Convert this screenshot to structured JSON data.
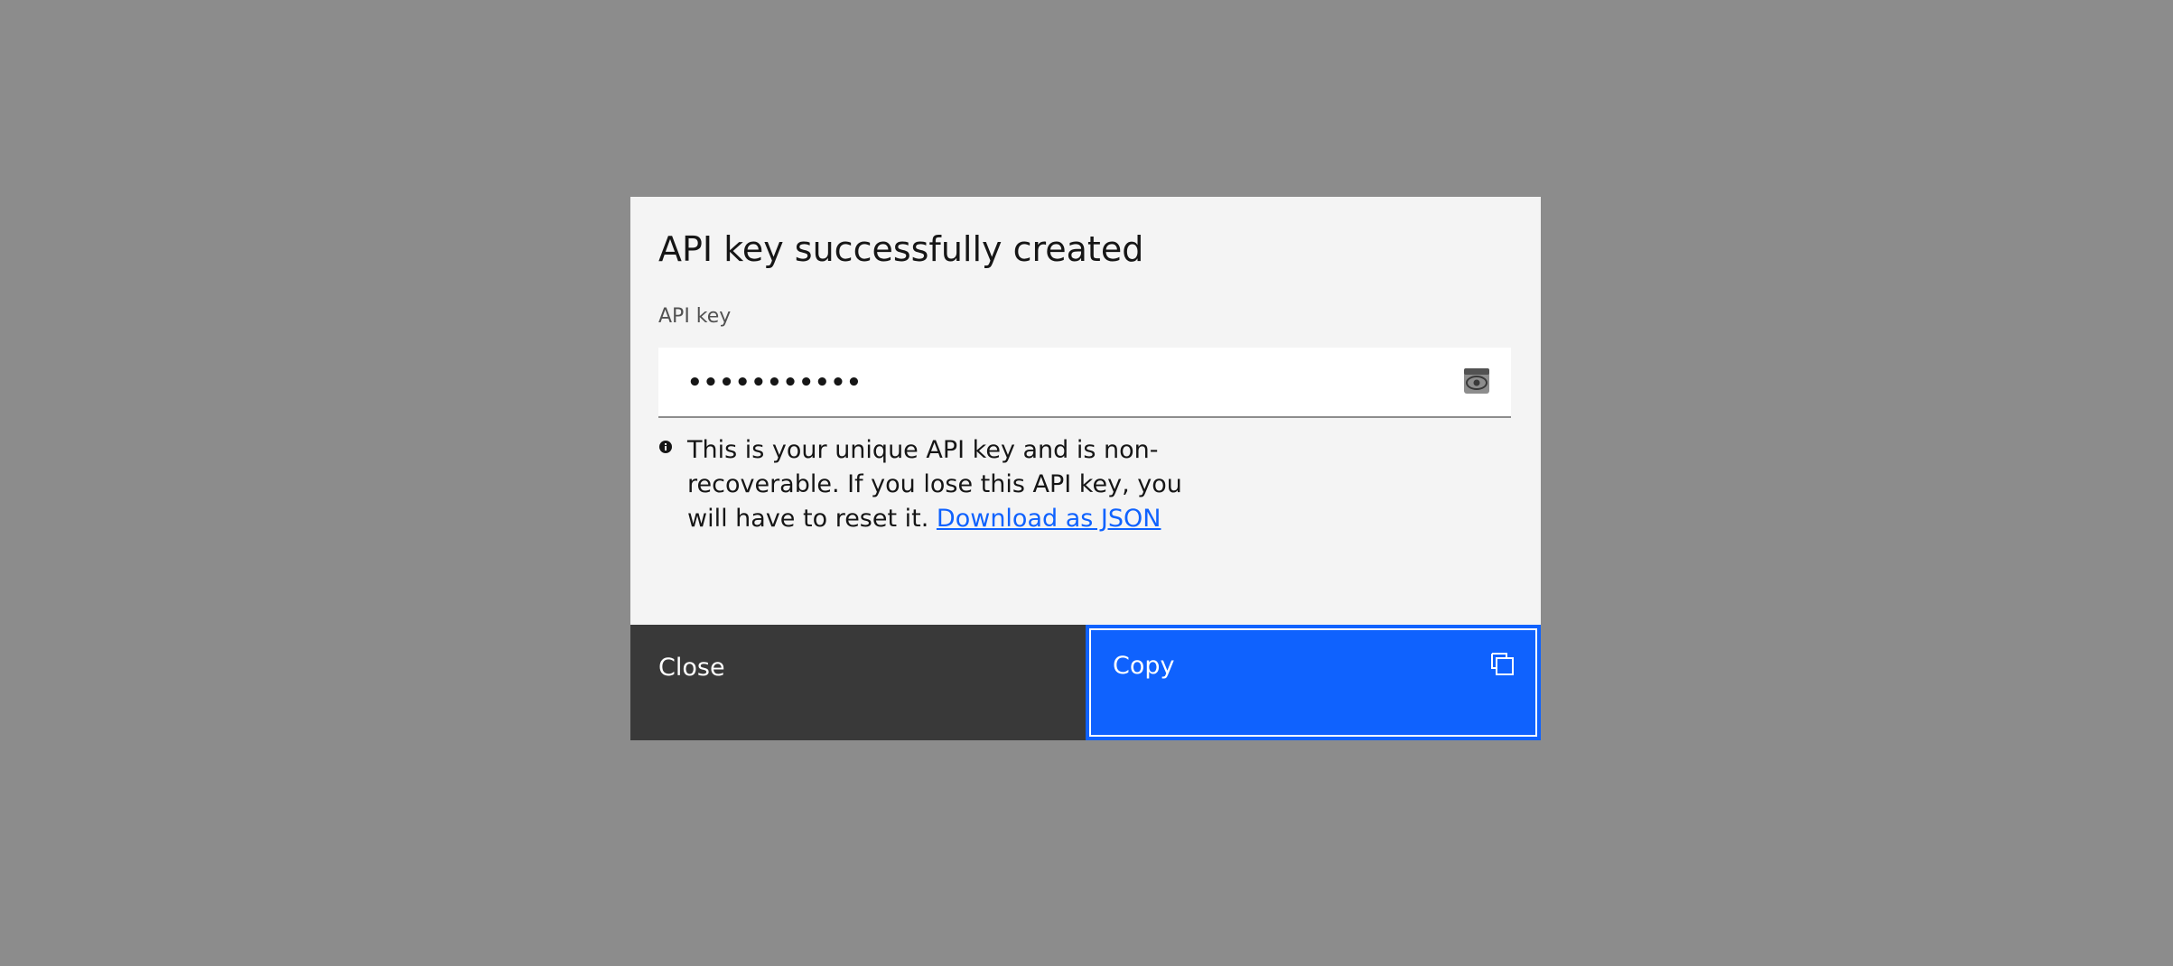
{
  "modal": {
    "title": "API key successfully created",
    "field_label": "API key",
    "field_value": "•••••••••••",
    "helper_text": "This is your unique API key and is non-recoverable. If you lose this API key, you will have to reset it.",
    "helper_link": "Download as JSON",
    "close_label": "Close",
    "copy_label": "Copy"
  },
  "icons": {
    "visibility": "eye-icon",
    "info": "info-icon",
    "copy": "copy-icon"
  },
  "colors": {
    "overlay": "#8c8c8c",
    "modal_bg": "#f4f4f4",
    "primary": "#0f62fe",
    "secondary": "#393939",
    "link": "#0f62fe"
  }
}
